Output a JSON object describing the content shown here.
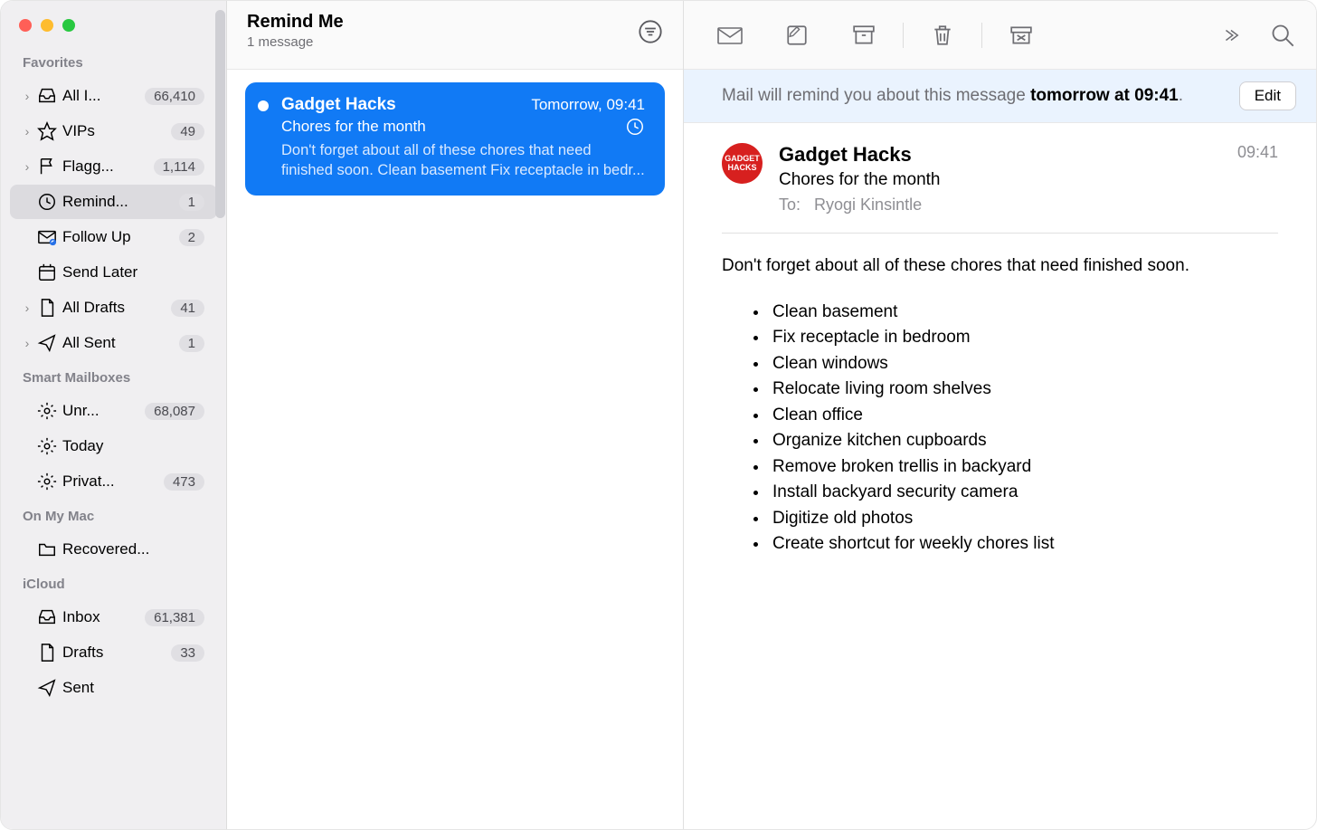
{
  "window": {
    "traffic": [
      "close",
      "minimize",
      "zoom"
    ]
  },
  "sidebar": {
    "sections": [
      {
        "title": "Favorites",
        "items": [
          {
            "label": "All I...",
            "count": "66,410",
            "icon": "inbox",
            "chevron": true
          },
          {
            "label": "VIPs",
            "count": "49",
            "icon": "star",
            "chevron": true
          },
          {
            "label": "Flagg...",
            "count": "1,114",
            "icon": "flag",
            "chevron": true
          },
          {
            "label": "Remind...",
            "count": "1",
            "icon": "clock",
            "active": true
          },
          {
            "label": "Follow Up",
            "count": "2",
            "icon": "followup"
          },
          {
            "label": "Send Later",
            "icon": "calendar"
          },
          {
            "label": "All Drafts",
            "count": "41",
            "icon": "doc",
            "chevron": true
          },
          {
            "label": "All Sent",
            "count": "1",
            "icon": "send",
            "chevron": true
          }
        ]
      },
      {
        "title": "Smart Mailboxes",
        "items": [
          {
            "label": "Unr...",
            "count": "68,087",
            "icon": "gear"
          },
          {
            "label": "Today",
            "icon": "gear"
          },
          {
            "label": "Privat...",
            "count": "473",
            "icon": "gear"
          }
        ]
      },
      {
        "title": "On My Mac",
        "items": [
          {
            "label": "Recovered...",
            "icon": "folder"
          }
        ]
      },
      {
        "title": "iCloud",
        "items": [
          {
            "label": "Inbox",
            "count": "61,381",
            "icon": "inbox"
          },
          {
            "label": "Drafts",
            "count": "33",
            "icon": "doc"
          },
          {
            "label": "Sent",
            "icon": "send"
          }
        ]
      }
    ]
  },
  "list": {
    "title": "Remind Me",
    "subtitle": "1 message",
    "messages": [
      {
        "sender": "Gadget Hacks",
        "time": "Tomorrow, 09:41",
        "subject": "Chores for the month",
        "preview": "Don't forget about all of these chores that need finished soon. Clean basement Fix receptacle in bedr..."
      }
    ]
  },
  "toolbar": {
    "buttons": [
      "reply",
      "compose",
      "archive",
      "delete",
      "junk",
      "more",
      "search"
    ]
  },
  "banner": {
    "prefix": "Mail will remind you about this message ",
    "bold": "tomorrow at 09:41",
    "suffix": ".",
    "edit": "Edit"
  },
  "message": {
    "from": "Gadget Hacks",
    "avatar_text": "GADGET HACKS",
    "time": "09:41",
    "subject": "Chores for the month",
    "to_label": "To:",
    "to_value": "Ryogi Kinsintle",
    "intro": "Don't forget about all of these chores that need finished soon.",
    "items": [
      "Clean basement",
      "Fix receptacle in bedroom",
      "Clean windows",
      "Relocate living room shelves",
      "Clean office",
      "Organize kitchen cupboards",
      "Remove broken trellis in backyard",
      "Install backyard security camera",
      "Digitize old photos",
      "Create shortcut for weekly chores list"
    ]
  }
}
